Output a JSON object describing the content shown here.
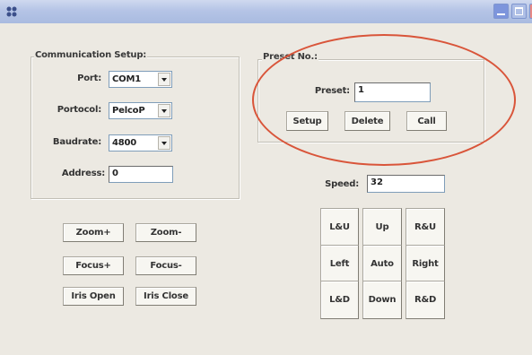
{
  "window": {
    "close_color": "#e88a86",
    "accent": "#a9bbe0"
  },
  "communication": {
    "title": "Communication Setup:",
    "port_label": "Port:",
    "port_value": "COM1",
    "protocol_label": "Portocol:",
    "protocol_value": "PelcoP",
    "baudrate_label": "Baudrate:",
    "baudrate_value": "4800",
    "address_label": "Address:",
    "address_value": "0"
  },
  "preset": {
    "title": "Preset No.:",
    "preset_label": "Preset:",
    "preset_value": "1",
    "setup_label": "Setup",
    "delete_label": "Delete",
    "call_label": "Call"
  },
  "speed": {
    "label": "Speed:",
    "value": "32"
  },
  "lens": {
    "zoom_in": "Zoom+",
    "zoom_out": "Zoom-",
    "focus_in": "Focus+",
    "focus_out": "Focus-",
    "iris_open": "Iris Open",
    "iris_close": "Iris Close"
  },
  "ptz": {
    "lu": "L&U",
    "up": "Up",
    "ru": "R&U",
    "left": "Left",
    "auto": "Auto",
    "right": "Right",
    "ld": "L&D",
    "down": "Down",
    "rd": "R&D"
  },
  "annotation": {
    "ellipse_color": "#d9553a"
  }
}
